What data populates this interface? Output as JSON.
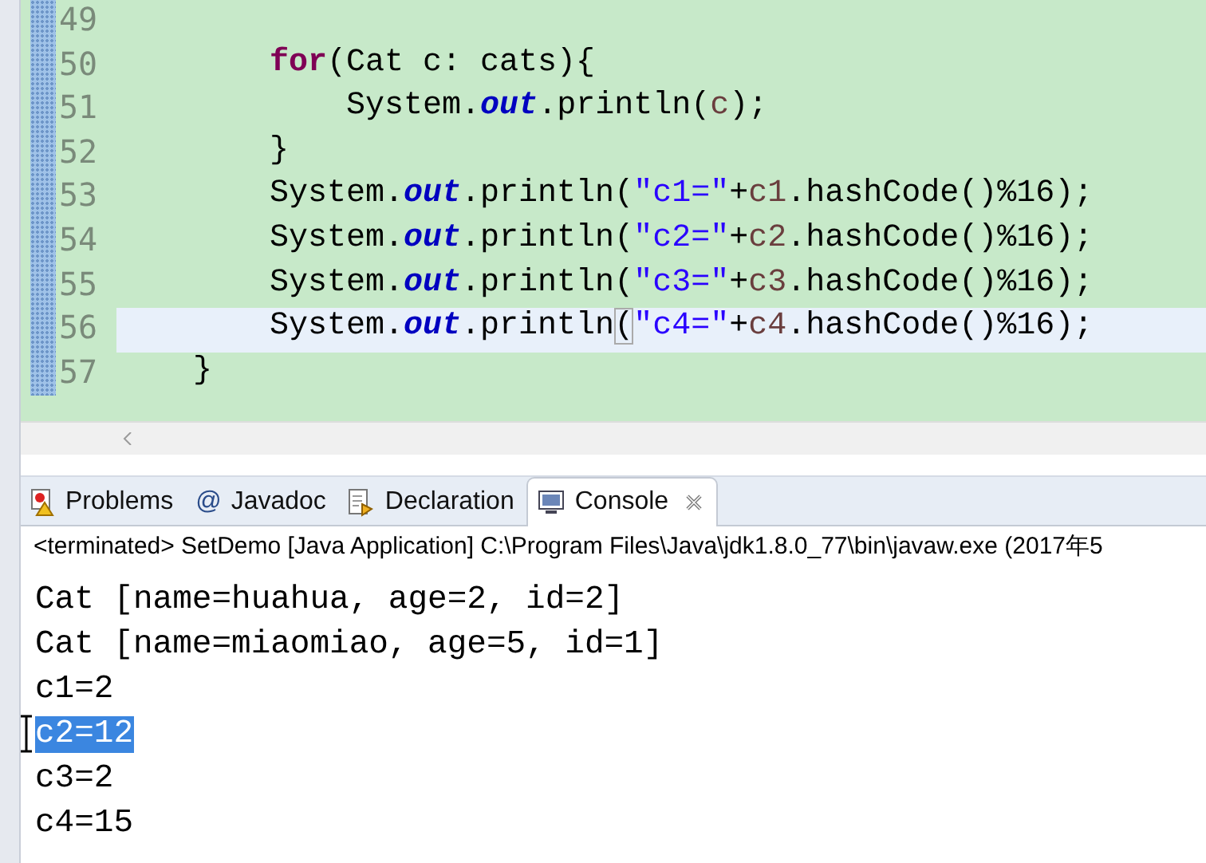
{
  "editor": {
    "lines": [
      {
        "number": "49",
        "current": false
      },
      {
        "number": "50",
        "current": false,
        "tokens": [
          {
            "kind": "keyword",
            "text": "        for"
          },
          {
            "kind": "plain",
            "text": "(Cat c: cats){"
          }
        ]
      },
      {
        "number": "51",
        "current": false,
        "tokens": [
          {
            "kind": "plain",
            "text": "            System."
          },
          {
            "kind": "field",
            "text": "out"
          },
          {
            "kind": "plain",
            "text": ".println("
          },
          {
            "kind": "var",
            "text": "c"
          },
          {
            "kind": "plain",
            "text": ");"
          }
        ]
      },
      {
        "number": "52",
        "current": false,
        "tokens": [
          {
            "kind": "plain",
            "text": "        }"
          }
        ]
      },
      {
        "number": "53",
        "current": false,
        "tokens": [
          {
            "kind": "plain",
            "text": "        System."
          },
          {
            "kind": "field",
            "text": "out"
          },
          {
            "kind": "plain",
            "text": ".println("
          },
          {
            "kind": "string",
            "text": "\"c1=\""
          },
          {
            "kind": "plain",
            "text": "+"
          },
          {
            "kind": "var",
            "text": "c1"
          },
          {
            "kind": "plain",
            "text": ".hashCode()%16);"
          }
        ]
      },
      {
        "number": "54",
        "current": false,
        "tokens": [
          {
            "kind": "plain",
            "text": "        System."
          },
          {
            "kind": "field",
            "text": "out"
          },
          {
            "kind": "plain",
            "text": ".println("
          },
          {
            "kind": "string",
            "text": "\"c2=\""
          },
          {
            "kind": "plain",
            "text": "+"
          },
          {
            "kind": "var",
            "text": "c2"
          },
          {
            "kind": "plain",
            "text": ".hashCode()%16);"
          }
        ]
      },
      {
        "number": "55",
        "current": false,
        "tokens": [
          {
            "kind": "plain",
            "text": "        System."
          },
          {
            "kind": "field",
            "text": "out"
          },
          {
            "kind": "plain",
            "text": ".println("
          },
          {
            "kind": "string",
            "text": "\"c3=\""
          },
          {
            "kind": "plain",
            "text": "+"
          },
          {
            "kind": "var",
            "text": "c3"
          },
          {
            "kind": "plain",
            "text": ".hashCode()%16);"
          }
        ]
      },
      {
        "number": "56",
        "current": true,
        "tokens": [
          {
            "kind": "plain",
            "text": "        System."
          },
          {
            "kind": "field",
            "text": "out"
          },
          {
            "kind": "plain",
            "text": ".println"
          },
          {
            "kind": "match",
            "text": "("
          },
          {
            "kind": "string",
            "text": "\"c4=\""
          },
          {
            "kind": "plain",
            "text": "+"
          },
          {
            "kind": "var",
            "text": "c4"
          },
          {
            "kind": "plain",
            "text": ".hashCode()%16);"
          }
        ]
      },
      {
        "number": "57",
        "current": false,
        "tokens": [
          {
            "kind": "plain",
            "text": "    }"
          }
        ]
      }
    ]
  },
  "tabs": [
    {
      "label": "Problems",
      "kind": "problems",
      "selected": false
    },
    {
      "label": "Javadoc",
      "kind": "javadoc",
      "glyph": "@",
      "selected": false
    },
    {
      "label": "Declaration",
      "kind": "declaration",
      "selected": false
    },
    {
      "label": "Console",
      "kind": "console",
      "selected": true
    }
  ],
  "console": {
    "status": "<terminated> SetDemo [Java Application] C:\\Program Files\\Java\\jdk1.8.0_77\\bin\\javaw.exe (2017年5",
    "lines": [
      {
        "text": "Cat [name=huahua, age=2, id=2]",
        "selected": false
      },
      {
        "text": "Cat [name=miaomiao, age=5, id=1]",
        "selected": false
      },
      {
        "text": "c1=2",
        "selected": false
      },
      {
        "text": "c2=12",
        "selected": true
      },
      {
        "text": "c3=2",
        "selected": false
      },
      {
        "text": "c4=15",
        "selected": false
      }
    ]
  }
}
